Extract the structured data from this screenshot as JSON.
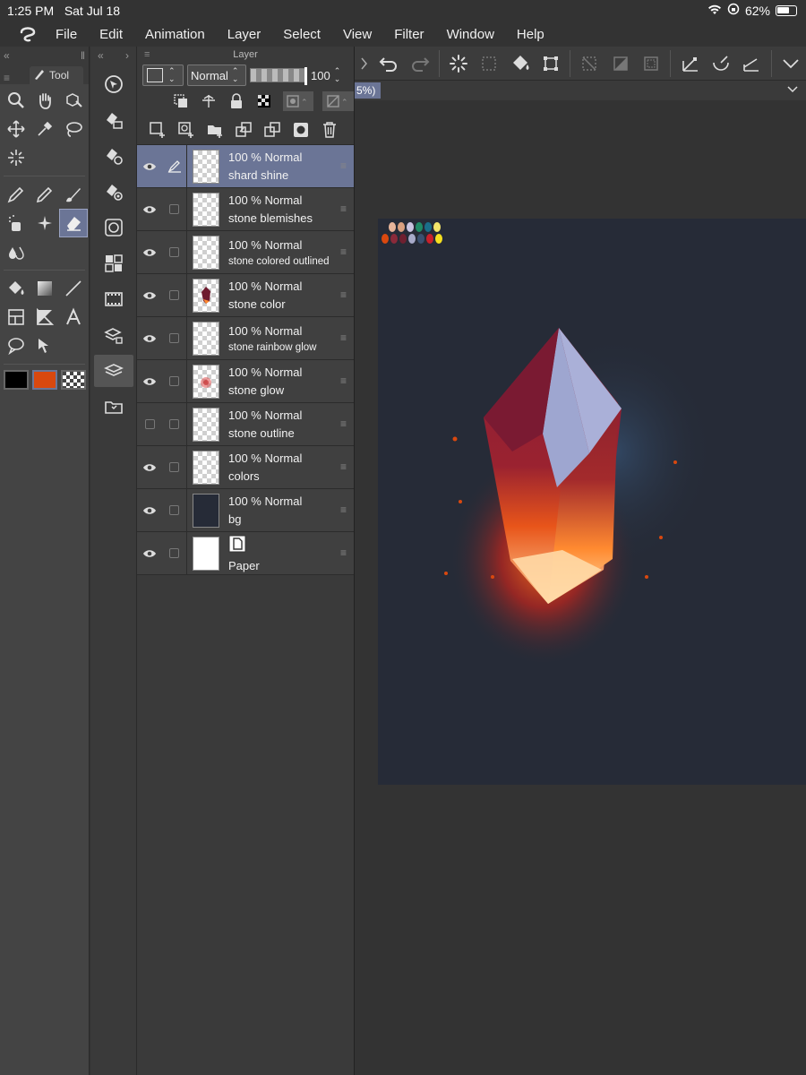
{
  "status": {
    "time": "1:25 PM",
    "date": "Sat Jul 18",
    "battery": "62%"
  },
  "menu": [
    "File",
    "Edit",
    "Animation",
    "Layer",
    "Select",
    "View",
    "Filter",
    "Window",
    "Help"
  ],
  "tool_panel": {
    "tab_label": "Tool"
  },
  "canvas_tab": {
    "label": "5%)"
  },
  "layer_panel": {
    "title": "Layer",
    "blend_mode": "Normal",
    "opacity_value": "100"
  },
  "layers": [
    {
      "mode": "100 % Normal",
      "name": "shard shine",
      "visible": true,
      "selected": true,
      "small": false,
      "thumb": "empty"
    },
    {
      "mode": "100 % Normal",
      "name": "stone blemishes",
      "visible": true,
      "selected": false,
      "small": false,
      "thumb": "empty"
    },
    {
      "mode": "100 % Normal",
      "name": "stone colored outlined",
      "visible": true,
      "selected": false,
      "small": true,
      "thumb": "empty"
    },
    {
      "mode": "100 % Normal",
      "name": "stone color",
      "visible": true,
      "selected": false,
      "small": false,
      "thumb": "crystal"
    },
    {
      "mode": "100 % Normal",
      "name": "stone rainbow glow",
      "visible": true,
      "selected": false,
      "small": true,
      "thumb": "empty"
    },
    {
      "mode": "100 % Normal",
      "name": "stone glow",
      "visible": true,
      "selected": false,
      "small": false,
      "thumb": "glow"
    },
    {
      "mode": "100 % Normal",
      "name": "stone outline",
      "visible": false,
      "selected": false,
      "small": false,
      "thumb": "empty"
    },
    {
      "mode": "100 % Normal",
      "name": "colors",
      "visible": true,
      "selected": false,
      "small": false,
      "thumb": "empty"
    },
    {
      "mode": "100 % Normal",
      "name": "bg",
      "visible": true,
      "selected": false,
      "small": false,
      "thumb": "dark"
    },
    {
      "mode": "",
      "name": "Paper",
      "visible": true,
      "selected": false,
      "small": false,
      "thumb": "paper"
    }
  ],
  "colors": {
    "accent": "#6b7596",
    "main_color": "#000000",
    "sub_color": "#d9480f",
    "canvas_bg": "#262b37"
  },
  "palette_dots": [
    "#e8b59a",
    "#d9a07f",
    "#c9c4e0",
    "#1f8a66",
    "#1a6e8a",
    "#f2e46a",
    "#d9480f",
    "#8a2a3a",
    "#6e2030",
    "#a7aac9",
    "#3a5070",
    "#c8202a",
    "#f5e020"
  ]
}
